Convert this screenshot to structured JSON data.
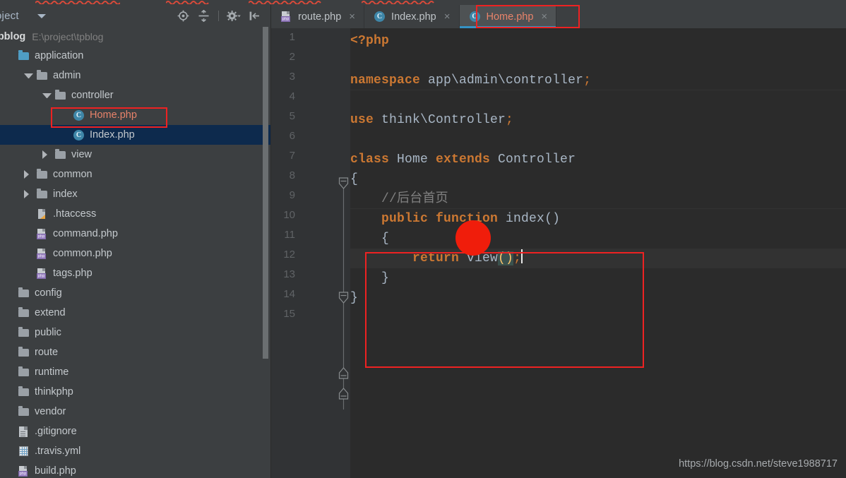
{
  "window": {
    "ide": "PhpStorm",
    "theme_bg": "#3c3f41",
    "editor_bg": "#2b2b2b",
    "accent": "#3592c4",
    "annotation_color": "#ee2222"
  },
  "sidebar": {
    "panel_title": "oject",
    "caret_icon": "chevron-down-icon",
    "toolbar": [
      {
        "name": "locate-target-icon",
        "label": "Select Opened File"
      },
      {
        "name": "collapse-all-icon",
        "label": "Collapse All"
      },
      {
        "name": "settings-gear-icon",
        "label": "Settings"
      },
      {
        "name": "hide-panel-icon",
        "label": "Hide"
      }
    ],
    "project": {
      "name": "tpblog",
      "path": "E:\\project\\tpblog"
    },
    "tree": [
      {
        "label": "application",
        "indent": 0,
        "arrow": "none",
        "icon": "folder-blue-icon",
        "selected": false,
        "modified": false
      },
      {
        "label": "admin",
        "indent": 1,
        "arrow": "down",
        "icon": "folder-gray-icon",
        "selected": false,
        "modified": false
      },
      {
        "label": "controller",
        "indent": 2,
        "arrow": "down",
        "icon": "folder-gray-icon",
        "selected": false,
        "modified": false
      },
      {
        "label": "Home.php",
        "indent": 3,
        "arrow": "none",
        "icon": "php-class-icon",
        "selected": false,
        "modified": true
      },
      {
        "label": "Index.php",
        "indent": 3,
        "arrow": "none",
        "icon": "php-class-icon",
        "selected": true,
        "modified": false
      },
      {
        "label": "view",
        "indent": 2,
        "arrow": "right",
        "icon": "folder-gray-icon",
        "selected": false,
        "modified": false
      },
      {
        "label": "common",
        "indent": 1,
        "arrow": "right",
        "icon": "folder-gray-icon",
        "selected": false,
        "modified": false
      },
      {
        "label": "index",
        "indent": 1,
        "arrow": "right",
        "icon": "folder-gray-icon",
        "selected": false,
        "modified": false
      },
      {
        "label": ".htaccess",
        "indent": 1,
        "arrow": "none",
        "icon": "htaccess-icon",
        "selected": false,
        "modified": false
      },
      {
        "label": "command.php",
        "indent": 1,
        "arrow": "none",
        "icon": "php-file-icon",
        "selected": false,
        "modified": false
      },
      {
        "label": "common.php",
        "indent": 1,
        "arrow": "none",
        "icon": "php-file-icon",
        "selected": false,
        "modified": false
      },
      {
        "label": "tags.php",
        "indent": 1,
        "arrow": "none",
        "icon": "php-file-icon",
        "selected": false,
        "modified": false
      },
      {
        "label": "config",
        "indent": 0,
        "arrow": "none",
        "icon": "folder-gray-icon",
        "selected": false,
        "modified": false
      },
      {
        "label": "extend",
        "indent": 0,
        "arrow": "none",
        "icon": "folder-gray-icon",
        "selected": false,
        "modified": false
      },
      {
        "label": "public",
        "indent": 0,
        "arrow": "none",
        "icon": "folder-gray-icon",
        "selected": false,
        "modified": false
      },
      {
        "label": "route",
        "indent": 0,
        "arrow": "none",
        "icon": "folder-gray-icon",
        "selected": false,
        "modified": false
      },
      {
        "label": "runtime",
        "indent": 0,
        "arrow": "none",
        "icon": "folder-gray-icon",
        "selected": false,
        "modified": false
      },
      {
        "label": "thinkphp",
        "indent": 0,
        "arrow": "none",
        "icon": "folder-gray-icon",
        "selected": false,
        "modified": false
      },
      {
        "label": "vendor",
        "indent": 0,
        "arrow": "none",
        "icon": "folder-gray-icon",
        "selected": false,
        "modified": false
      },
      {
        "label": ".gitignore",
        "indent": 0,
        "arrow": "none",
        "icon": "text-doc-icon",
        "selected": false,
        "modified": false
      },
      {
        "label": ".travis.yml",
        "indent": 0,
        "arrow": "none",
        "icon": "yml-grid-icon",
        "selected": false,
        "modified": false
      },
      {
        "label": "build.php",
        "indent": 0,
        "arrow": "none",
        "icon": "php-file-icon",
        "selected": false,
        "modified": false
      }
    ]
  },
  "editor": {
    "tabs": [
      {
        "label": "route.php",
        "icon": "php-file-icon",
        "active": false,
        "modified": false,
        "close_icon": "close-icon"
      },
      {
        "label": "Index.php",
        "icon": "php-class-icon",
        "active": false,
        "modified": false,
        "close_icon": "close-icon"
      },
      {
        "label": "Home.php",
        "icon": "php-class-icon",
        "active": true,
        "modified": true,
        "close_icon": "close-icon"
      }
    ],
    "line_numbers": [
      "1",
      "2",
      "3",
      "4",
      "5",
      "6",
      "7",
      "8",
      "9",
      "10",
      "11",
      "12",
      "13",
      "14",
      "15"
    ],
    "code_lines": [
      {
        "n": 1,
        "tokens": [
          {
            "t": "<?php",
            "c": "kw"
          }
        ]
      },
      {
        "n": 2,
        "tokens": []
      },
      {
        "n": 3,
        "tokens": [
          {
            "t": "namespace ",
            "c": "kw"
          },
          {
            "t": "app\\admin\\controller",
            "c": "id"
          },
          {
            "t": ";",
            "c": "semi"
          }
        ]
      },
      {
        "n": 4,
        "tokens": []
      },
      {
        "n": 5,
        "tokens": [
          {
            "t": "use ",
            "c": "kw"
          },
          {
            "t": "think\\Controller",
            "c": "id"
          },
          {
            "t": ";",
            "c": "semi"
          }
        ]
      },
      {
        "n": 6,
        "tokens": []
      },
      {
        "n": 7,
        "tokens": [
          {
            "t": "class ",
            "c": "kw"
          },
          {
            "t": "Home ",
            "c": "id"
          },
          {
            "t": "extends ",
            "c": "kw"
          },
          {
            "t": "Controller",
            "c": "id"
          }
        ]
      },
      {
        "n": 8,
        "tokens": [
          {
            "t": "{",
            "c": "brace"
          }
        ]
      },
      {
        "n": 9,
        "tokens": [
          {
            "t": "    //后台首页",
            "c": "cm"
          }
        ]
      },
      {
        "n": 10,
        "tokens": [
          {
            "t": "    public function ",
            "c": "kw"
          },
          {
            "t": "index",
            "c": "id"
          },
          {
            "t": "()",
            "c": "pn"
          }
        ]
      },
      {
        "n": 11,
        "tokens": [
          {
            "t": "    {",
            "c": "brace"
          }
        ]
      },
      {
        "n": 12,
        "tokens": [
          {
            "t": "        return ",
            "c": "kw"
          },
          {
            "t": "view",
            "c": "id"
          },
          {
            "t": "()",
            "c": "hl-paren"
          },
          {
            "t": ";",
            "c": "semi"
          }
        ]
      },
      {
        "n": 13,
        "tokens": [
          {
            "t": "    }",
            "c": "brace"
          }
        ]
      },
      {
        "n": 14,
        "tokens": [
          {
            "t": "}",
            "c": "brace"
          }
        ]
      },
      {
        "n": 15,
        "tokens": []
      }
    ],
    "current_line": 12,
    "fold_markers": [
      {
        "line": 7,
        "type": "expanded-start"
      },
      {
        "line": 10,
        "type": "expanded-start"
      },
      {
        "line": 13,
        "type": "expanded-end"
      },
      {
        "line": 14,
        "type": "expanded-end"
      }
    ]
  },
  "annotations": {
    "tab_highlight_label": "Home.php",
    "tree_highlight_label": "Home.php",
    "circle_marker": "red-dot-annotation",
    "code_box": "index-method-annotation"
  },
  "watermark": {
    "text": "https://blog.csdn.net/steve1988717"
  }
}
